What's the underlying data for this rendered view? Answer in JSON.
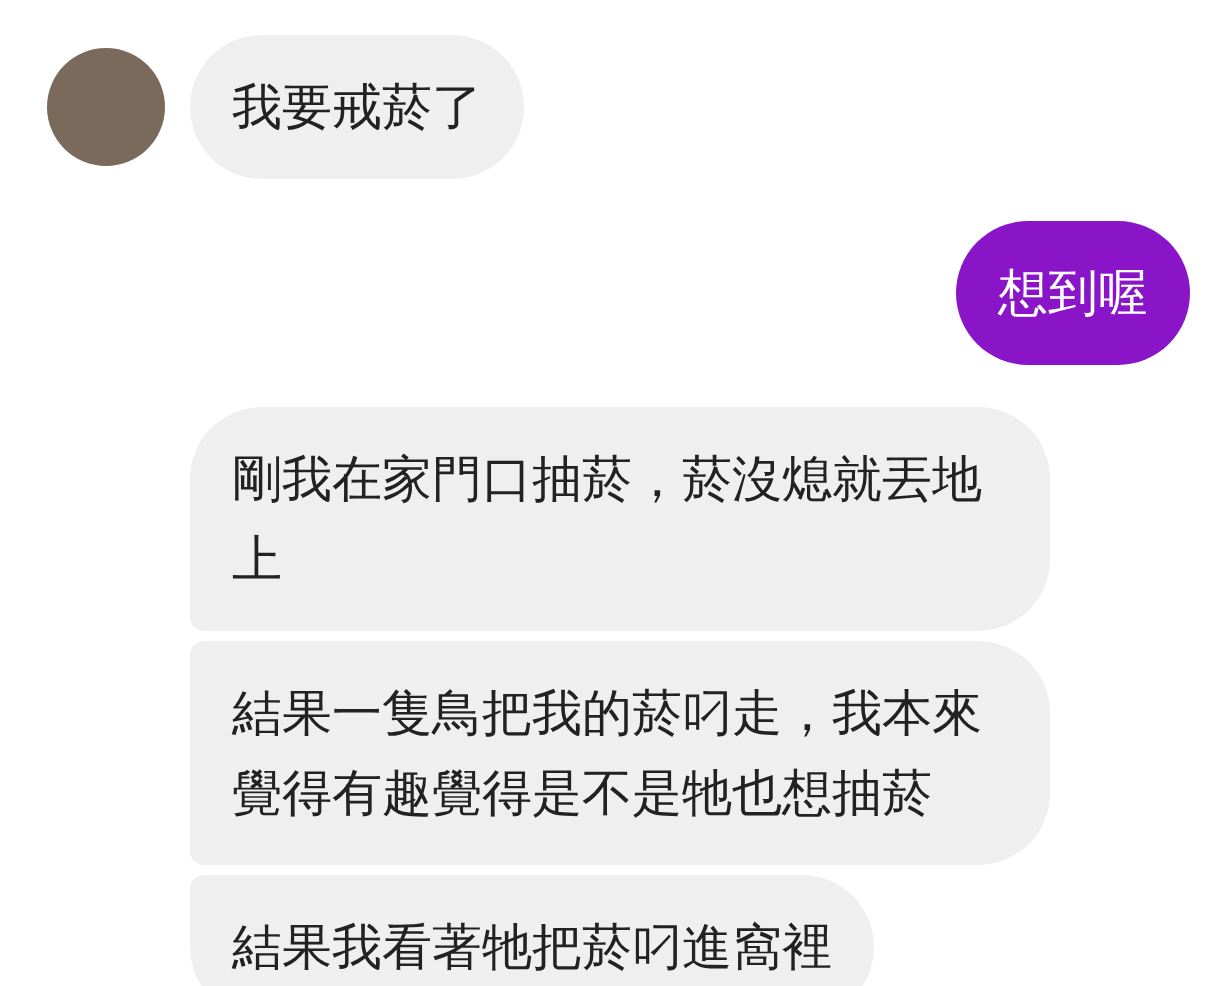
{
  "messages": [
    {
      "kind": "received",
      "avatar": true,
      "text": "我要戒菸了"
    },
    {
      "kind": "sent",
      "avatar": false,
      "text": "想到喔"
    },
    {
      "kind": "received",
      "avatar": false,
      "text": "剛我在家門口抽菸，菸沒熄就丟地上"
    },
    {
      "kind": "received",
      "avatar": false,
      "text": "結果一隻鳥把我的菸叼走，我本來覺得有趣覺得是不是牠也想抽菸"
    },
    {
      "kind": "received",
      "avatar": false,
      "text": "結果我看著牠把菸叼進窩裡"
    }
  ]
}
